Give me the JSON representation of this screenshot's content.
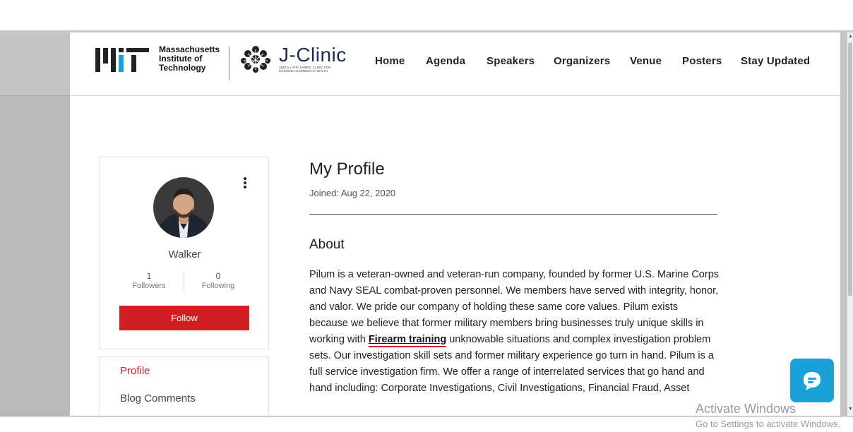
{
  "header": {
    "org_name": [
      "Massachusetts",
      "Institute of",
      "Technology"
    ],
    "brand_name": "J-Clinic",
    "brand_subtitle": [
      "ABDUL LATIF JAMEEL CLINIC FOR",
      "MACHINE LEARNING IN HEALTH"
    ],
    "nav": [
      {
        "label": "Home"
      },
      {
        "label": "Agenda"
      },
      {
        "label": "Speakers"
      },
      {
        "label": "Organizers"
      },
      {
        "label": "Venue"
      },
      {
        "label": "Posters"
      },
      {
        "label": "Stay Updated"
      }
    ]
  },
  "profile": {
    "name": "Walker",
    "followers_count": "1",
    "followers_label": "Followers",
    "following_count": "0",
    "following_label": "Following",
    "follow_label": "Follow"
  },
  "menu": {
    "items": [
      "Profile",
      "Blog Comments"
    ]
  },
  "main": {
    "title": "My Profile",
    "joined": "Joined: Aug 22, 2020",
    "about_heading": "About",
    "about_text_before": "Pilum is a veteran-owned and veteran-run company, founded by former U.S. Marine Corps and Navy SEAL combat-proven personnel. We members have served with integrity, honor, and valor. We pride our company of holding these same core values. Pilum exists because we believe that former military members bring businesses truly unique skills in working with ",
    "about_link": "Firearm training",
    "about_text_after": " unknowable situations and complex investigation problem sets. Our investigation skill sets and former military experience go turn in hand. Pilum is a full service investigation firm. We offer a range of interrelated services that go hand and hand including: Corporate Investigations, Civil Investigations, Financial Fraud, Asset Investigations, Background Checks and Surveillance."
  },
  "overlay": {
    "activate_title": "Activate Windows",
    "activate_sub": "Go to Settings to activate Windows."
  },
  "colors": {
    "accent_red": "#d21f24",
    "chat_blue": "#1aa1d8",
    "brand_navy": "#1f2a52"
  },
  "icons": [
    "more-vertical-icon",
    "chat-icon",
    "mit-logo",
    "jclinic-logo"
  ]
}
